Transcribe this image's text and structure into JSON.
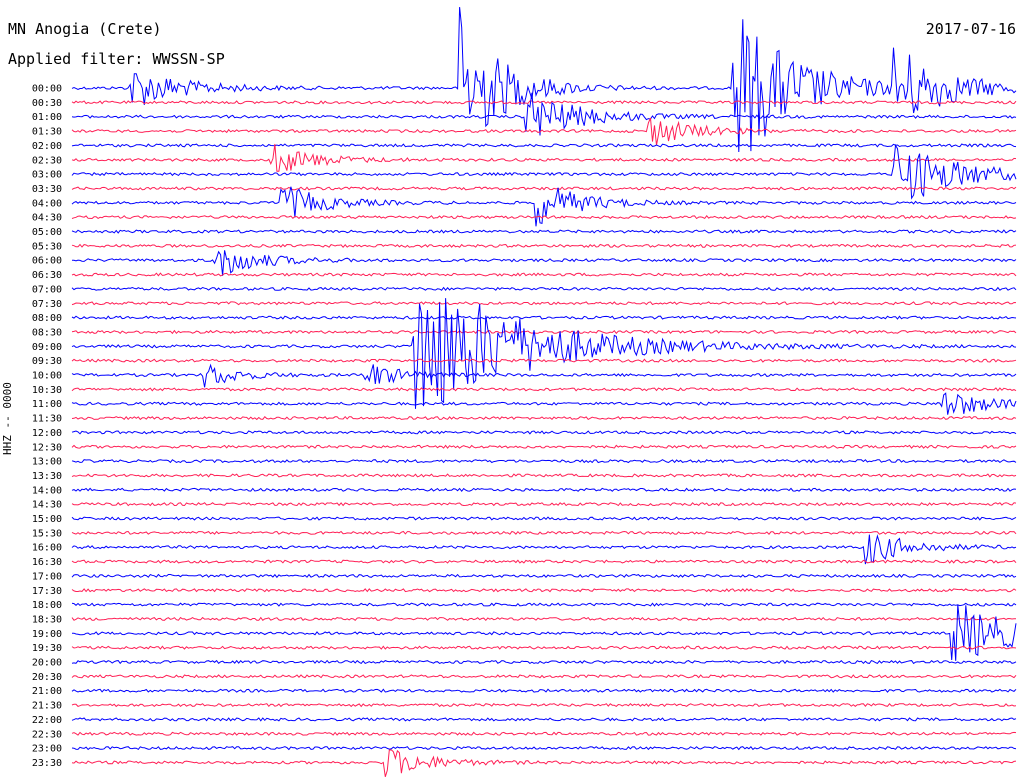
{
  "header": {
    "title": "MN Anogia (Crete)",
    "filter": "Applied filter: WWSSN-SP",
    "date": "2017-07-16"
  },
  "axis": {
    "channel_label": "HHZ -- 0000"
  },
  "chart_data": {
    "type": "line",
    "title": "MN Anogia (Crete)",
    "subtitle": "Applied filter: WWSSN-SP",
    "date": "2017-07-16",
    "ylabel": "HHZ -- 0000",
    "trace_colors": [
      "#0000ff",
      "#ff1f55"
    ],
    "row_interval_minutes": 30,
    "row_labels": [
      "00:00",
      "00:30",
      "01:00",
      "01:30",
      "02:00",
      "02:30",
      "03:00",
      "03:30",
      "04:00",
      "04:30",
      "05:00",
      "05:30",
      "06:00",
      "06:30",
      "07:00",
      "07:30",
      "08:00",
      "08:30",
      "09:00",
      "09:30",
      "10:00",
      "10:30",
      "11:00",
      "11:30",
      "12:00",
      "12:30",
      "13:00",
      "13:30",
      "14:00",
      "14:30",
      "15:00",
      "15:30",
      "16:00",
      "16:30",
      "17:00",
      "17:30",
      "18:00",
      "18:30",
      "19:00",
      "19:30",
      "20:00",
      "20:30",
      "21:00",
      "21:30",
      "22:00",
      "22:30",
      "23:00",
      "23:30"
    ],
    "events": [
      {
        "row": 0,
        "start": 0.06,
        "amp": 1.6,
        "dur": 0.05
      },
      {
        "row": 0,
        "start": 0.41,
        "amp": 6.0,
        "dur": 0.04
      },
      {
        "row": 0,
        "start": 0.7,
        "amp": 6.0,
        "dur": 0.06
      },
      {
        "row": 0,
        "start": 0.87,
        "amp": 3.0,
        "dur": 0.05
      },
      {
        "row": 2,
        "start": 0.48,
        "amp": 2.0,
        "dur": 0.05
      },
      {
        "row": 3,
        "start": 0.61,
        "amp": 1.2,
        "dur": 0.04
      },
      {
        "row": 5,
        "start": 0.21,
        "amp": 1.2,
        "dur": 0.04
      },
      {
        "row": 6,
        "start": 0.87,
        "amp": 2.5,
        "dur": 0.06
      },
      {
        "row": 8,
        "start": 0.22,
        "amp": 1.4,
        "dur": 0.04
      },
      {
        "row": 8,
        "start": 0.49,
        "amp": 1.8,
        "dur": 0.04
      },
      {
        "row": 12,
        "start": 0.15,
        "amp": 1.4,
        "dur": 0.04
      },
      {
        "row": 18,
        "start": 0.36,
        "amp": 6.0,
        "dur": 0.1
      },
      {
        "row": 20,
        "start": 0.14,
        "amp": 1.0,
        "dur": 0.03
      },
      {
        "row": 20,
        "start": 0.31,
        "amp": 1.1,
        "dur": 0.03
      },
      {
        "row": 22,
        "start": 0.92,
        "amp": 1.2,
        "dur": 0.04
      },
      {
        "row": 32,
        "start": 0.84,
        "amp": 1.3,
        "dur": 0.04
      },
      {
        "row": 38,
        "start": 0.93,
        "amp": 2.5,
        "dur": 0.06
      },
      {
        "row": 47,
        "start": 0.33,
        "amp": 1.2,
        "dur": 0.04
      }
    ]
  }
}
